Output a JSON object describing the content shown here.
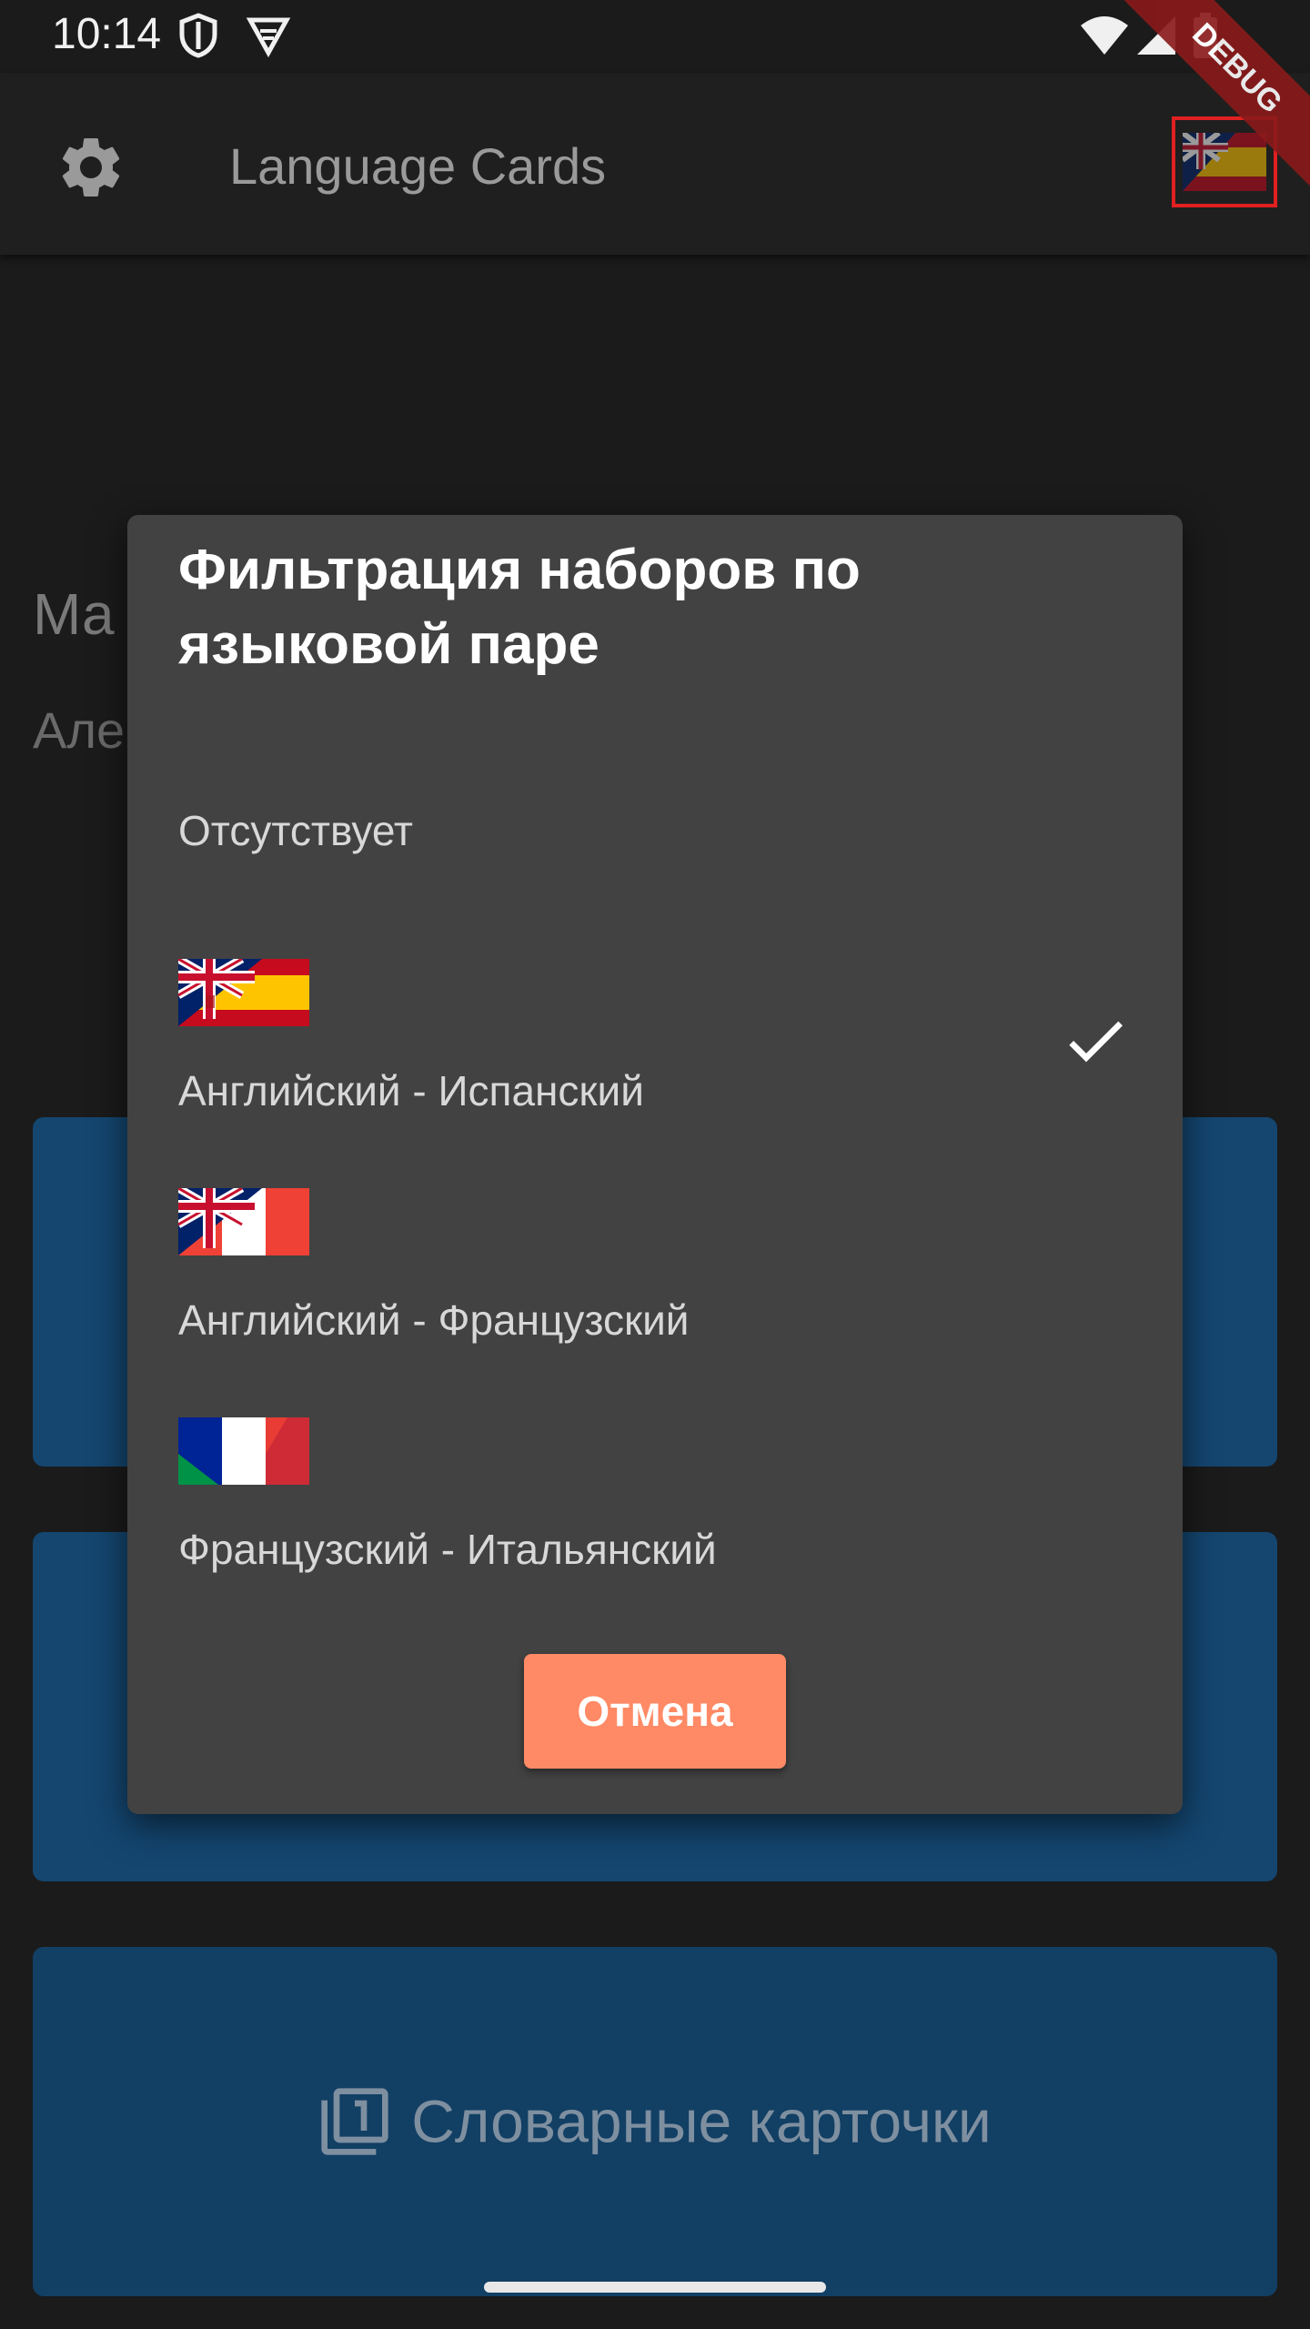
{
  "status_bar": {
    "time": "10:14",
    "icons": [
      "shield-icon",
      "vpn-icon",
      "wifi-icon",
      "signal-icon",
      "battery-icon"
    ]
  },
  "debug_banner": "DEBUG",
  "app_bar": {
    "title": "Language Cards",
    "settings_icon": "gear-icon",
    "flag_icon": "uk-spain-flag-icon"
  },
  "background": {
    "heading_partial": "Ма",
    "subheading_partial": "Але",
    "card3_label": "Словарные карточки",
    "card3_icon": "filter-1-icon"
  },
  "dialog": {
    "title": "Фильтрация наборов по языковой паре",
    "options": [
      {
        "label": "Отсутствует"
      },
      {
        "label": "Английский - Испанский",
        "flag": "uk-spain-flag",
        "selected": true
      },
      {
        "label": "Английский - Французский",
        "flag": "uk-france-flag"
      },
      {
        "label": "Французский - Итальянский",
        "flag": "france-italy-flag"
      }
    ],
    "cancel_label": "Отмена"
  },
  "colors": {
    "cancel": "#ff8a65",
    "dialog": "#424242",
    "card": "#144670"
  }
}
